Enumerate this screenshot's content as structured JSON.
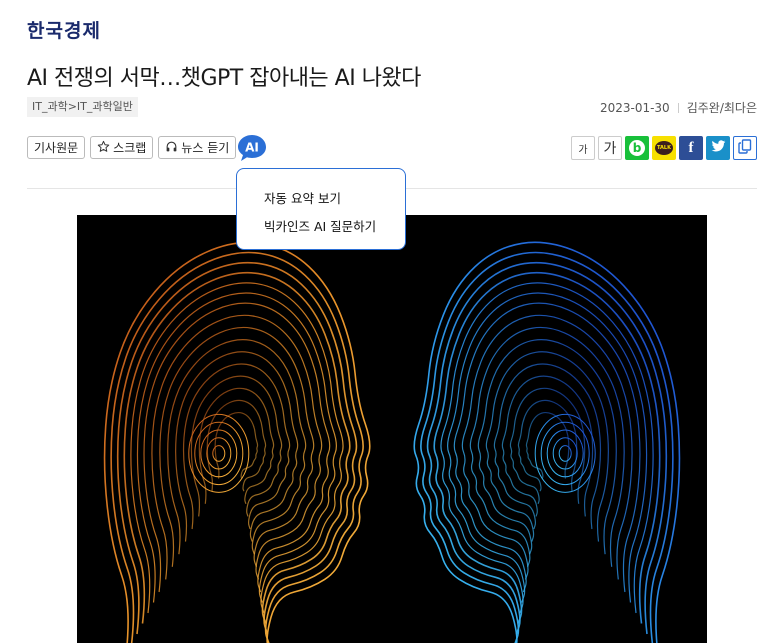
{
  "publisher": {
    "logo_text": "한국경제"
  },
  "article": {
    "headline": "AI 전쟁의 서막…챗GPT 잡아내는 AI 나왔다",
    "category": "IT_과학>IT_과학일반",
    "date": "2023-01-30",
    "authors": "김주완/최다은"
  },
  "toolbar": {
    "original_label": "기사원문",
    "scrap_label": "스크랩",
    "listen_label": "뉴스 듣기",
    "ai_label": "AI",
    "font_small_label": "가",
    "font_large_label": "가"
  },
  "share": {
    "blog_label": "b",
    "kakao_label": "TALK",
    "facebook_label": "f"
  },
  "ai_menu": {
    "items": [
      "자동 요약 보기",
      "빅카인즈 AI 질문하기"
    ]
  },
  "image": {
    "subject": "two-faces-contour-illustration",
    "colors": {
      "left": "#e8932a",
      "right": "#2a8fe8",
      "background": "#000000"
    }
  },
  "colors": {
    "brand": "#1a2a6c",
    "accent": "#2b6fd6"
  }
}
